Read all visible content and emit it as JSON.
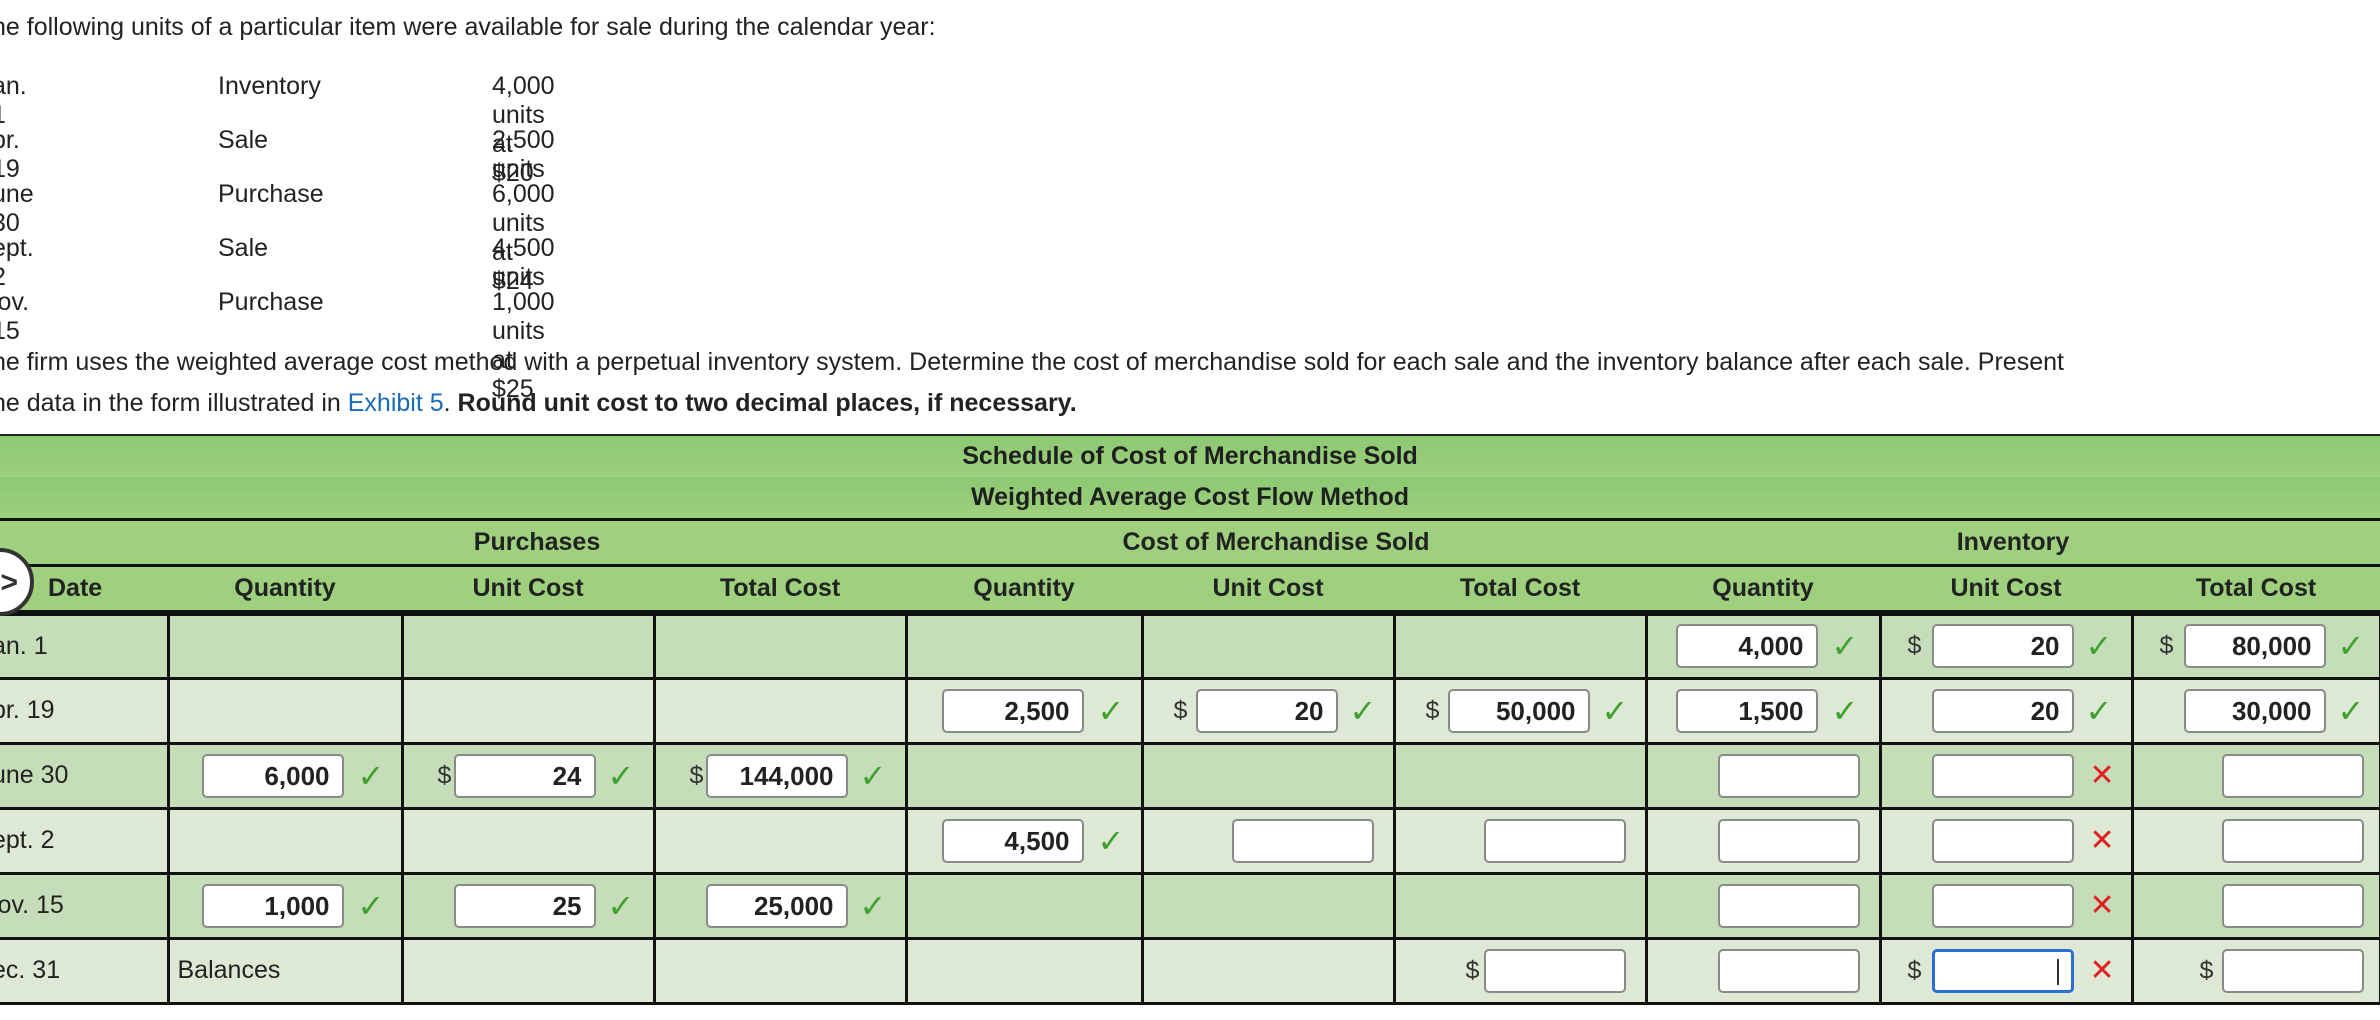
{
  "intro": "he following units of a particular item were available for sale during the calendar year:",
  "transactions": [
    {
      "date": "an. 1",
      "type": "Inventory",
      "detail": "4,000 units at $20"
    },
    {
      "date": "pr. 19",
      "type": "Sale",
      "detail": "2,500 units"
    },
    {
      "date": "une 30",
      "type": "Purchase",
      "detail": "6,000 units at $24"
    },
    {
      "date": "ept. 2",
      "type": "Sale",
      "detail": "4,500 units"
    },
    {
      "date": "lov. 15",
      "type": "Purchase",
      "detail": "1,000 units at $25"
    }
  ],
  "instructions": {
    "line1": "he firm uses the weighted average cost method with a perpetual inventory system. Determine the cost of merchandise sold for each sale and the inventory balance after each sale. Present",
    "line2_prefix": "he data in the form illustrated in ",
    "link": "Exhibit 5",
    "line2_mid": ". ",
    "bold": "Round unit cost to two decimal places, if necessary."
  },
  "schedule": {
    "title1": "Schedule of Cost of Merchandise Sold",
    "title2": "Weighted Average Cost Flow Method",
    "groups": {
      "purchases": "Purchases",
      "cogs": "Cost of Merchandise Sold",
      "inventory": "Inventory"
    },
    "columns": [
      "Date",
      "Quantity",
      "Unit Cost",
      "Total Cost",
      "Quantity",
      "Unit Cost",
      "Total Cost",
      "Quantity",
      "Unit Cost",
      "Total Cost"
    ],
    "currency": "$",
    "rows": [
      {
        "date": "an. 1",
        "inv_qty": "4,000",
        "inv_unit": "20",
        "inv_total": "80,000"
      },
      {
        "date": "pr. 19",
        "cogs_qty": "2,500",
        "cogs_unit": "20",
        "cogs_total": "50,000",
        "inv_qty": "1,500",
        "inv_unit": "20",
        "inv_total": "30,000"
      },
      {
        "date": "une 30",
        "p_qty": "6,000",
        "p_unit": "24",
        "p_total": "144,000",
        "inv_qty": "",
        "inv_unit": "",
        "inv_total": ""
      },
      {
        "date": "ept. 2",
        "cogs_qty": "4,500",
        "cogs_unit": "",
        "cogs_total": "",
        "inv_qty": "",
        "inv_unit": "",
        "inv_total": ""
      },
      {
        "date": "lov. 15",
        "p_qty": "1,000",
        "p_unit": "25",
        "p_total": "25,000",
        "inv_qty": "",
        "inv_unit": "",
        "inv_total": ""
      },
      {
        "date": "ec. 31",
        "label": "Balances",
        "cogs_total": "",
        "inv_qty": "",
        "inv_unit": "",
        "inv_total": ""
      }
    ]
  },
  "colors": {
    "header_green": "#9ed07d",
    "row_dark": "#c5ddb9",
    "row_light": "#dde9d5",
    "check": "#3ea12d",
    "x": "#e02020",
    "link": "#1a6bb8"
  },
  "icons": {
    "correct": "check-icon",
    "incorrect": "x-icon",
    "expand": "chevron-right-icon"
  }
}
